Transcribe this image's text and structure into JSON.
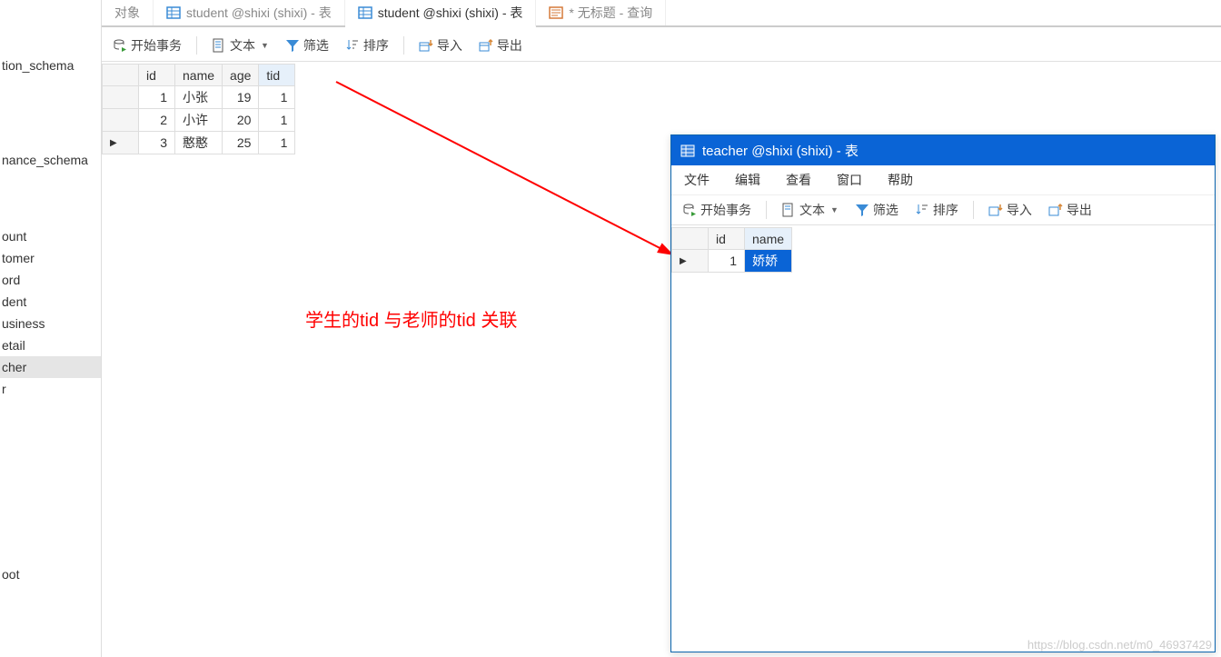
{
  "sidebar": {
    "top_items": [
      "tion_schema",
      "nance_schema"
    ],
    "mid_items": [
      "ount",
      "tomer",
      "ord",
      "dent",
      "usiness",
      "etail",
      "cher",
      "r"
    ],
    "bot_items": [
      "oot"
    ]
  },
  "tabs": [
    {
      "label": "对象",
      "active": false,
      "icon": "null"
    },
    {
      "label": "student @shixi (shixi) - 表",
      "active": false,
      "icon": "table"
    },
    {
      "label": "student @shixi (shixi) - 表",
      "active": true,
      "icon": "table"
    },
    {
      "label": "* 无标题 - 查询",
      "active": false,
      "icon": "query"
    }
  ],
  "toolbar": {
    "begin_trans": "开始事务",
    "text": "文本",
    "filter": "筛选",
    "sort": "排序",
    "import": "导入",
    "export": "导出"
  },
  "student_table": {
    "columns": [
      "id",
      "name",
      "age",
      "tid"
    ],
    "rows": [
      {
        "id": 1,
        "name": "小张",
        "age": 19,
        "tid": 1,
        "indicator": ""
      },
      {
        "id": 2,
        "name": "小许",
        "age": 20,
        "tid": 1,
        "indicator": ""
      },
      {
        "id": 3,
        "name": "憨憨",
        "age": 25,
        "tid": 1,
        "indicator": "▶"
      }
    ]
  },
  "annotation_text": "学生的tid 与老师的tid 关联",
  "sub_window": {
    "title": "teacher @shixi (shixi) - 表",
    "menu": [
      "文件",
      "编辑",
      "查看",
      "窗口",
      "帮助"
    ]
  },
  "teacher_table": {
    "columns": [
      "id",
      "name"
    ],
    "rows": [
      {
        "id": 1,
        "name": "娇娇",
        "indicator": "▶"
      }
    ]
  },
  "watermark": "https://blog.csdn.net/m0_46937429",
  "colors": {
    "accent_blue": "#0a64d6",
    "red": "#f00",
    "header_bg": "#f5f5f5"
  }
}
